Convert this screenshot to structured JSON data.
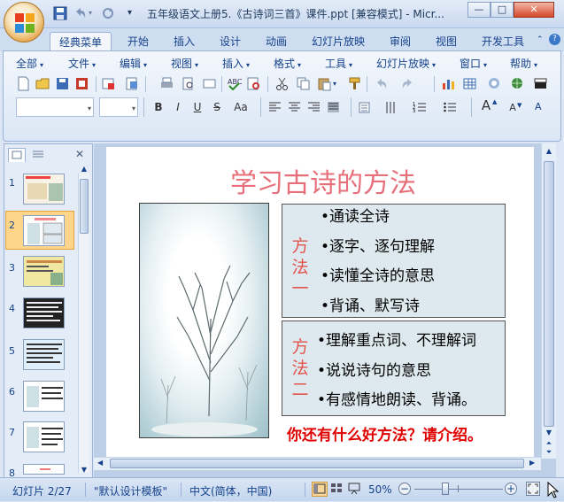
{
  "window": {
    "title": "五年级语文上册5.《古诗词三首》课件.ppt [兼容模式] - Micr...",
    "minimize": "—",
    "maximize": "□",
    "close": "✕"
  },
  "quick_access": [
    "save-icon",
    "undo-icon",
    "redo-icon",
    "customize-icon"
  ],
  "tabs": [
    {
      "label": "经典菜单",
      "active": true
    },
    {
      "label": "开始"
    },
    {
      "label": "插入"
    },
    {
      "label": "设计"
    },
    {
      "label": "动画"
    },
    {
      "label": "幻灯片放映"
    },
    {
      "label": "审阅"
    },
    {
      "label": "视图"
    },
    {
      "label": "开发工具"
    }
  ],
  "menus": [
    {
      "label": "全部"
    },
    {
      "label": "文件"
    },
    {
      "label": "编辑"
    },
    {
      "label": "视图"
    },
    {
      "label": "插入"
    },
    {
      "label": "格式"
    },
    {
      "label": "工具"
    },
    {
      "label": "幻灯片放映"
    },
    {
      "label": "窗口"
    },
    {
      "label": "帮助"
    }
  ],
  "format_buttons": {
    "bold": "B",
    "italic": "I",
    "underline": "U",
    "strike": "S",
    "case": "Aa"
  },
  "font_size_buttons": {
    "increase": "A",
    "decrease": "A"
  },
  "slide_pane": {
    "tabs": [
      "slides-tab-icon",
      "outline-tab-icon"
    ],
    "close": "✕",
    "thumbnails": [
      {
        "num": "1"
      },
      {
        "num": "2",
        "selected": true
      },
      {
        "num": "3"
      },
      {
        "num": "4"
      },
      {
        "num": "5"
      },
      {
        "num": "6"
      },
      {
        "num": "7"
      },
      {
        "num": "8"
      }
    ]
  },
  "slide": {
    "title": "学习古诗的方法",
    "method1": {
      "label": [
        "方",
        "法",
        "一"
      ],
      "bullets": [
        "•通读全诗",
        "•逐字、逐句理解",
        "•读懂全诗的意思",
        "•背诵、默写诗"
      ]
    },
    "method2": {
      "label": [
        "方",
        "法",
        "二"
      ],
      "bullets": [
        "•理解重点词、不理解词",
        "•说说诗句的意思",
        "•有感情地朗读、背诵。"
      ]
    },
    "question": "你还有什么好方法？请介绍。"
  },
  "status": {
    "slide_info": "幻灯片 2/27",
    "theme": "\"默认设计模板\"",
    "language": "中文(简体，中国)",
    "zoom": "50%",
    "zoom_level": 0.5
  },
  "colors": {
    "title_pink": "#e76f7a",
    "method_red": "#e3544f",
    "question_red": "#e10000",
    "selected_thumb": "#fdd58a"
  }
}
